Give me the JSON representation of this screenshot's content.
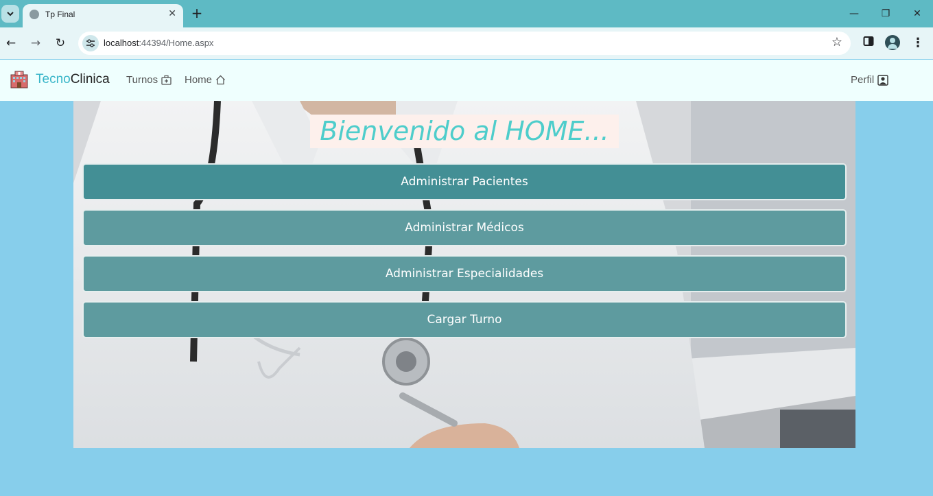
{
  "browser": {
    "tab_title": "Tp Final",
    "url_host": "localhost",
    "url_path": ":44394/Home.aspx"
  },
  "brand": {
    "part1": "Tecno",
    "part2": "Clinica",
    "color_part1": "#39b6c9"
  },
  "nav": {
    "turnos": "Turnos",
    "home": "Home",
    "perfil": "Perfil"
  },
  "hero": {
    "title": "Bienvenido al HOME..."
  },
  "buttons": [
    {
      "label": "Administrar Pacientes"
    },
    {
      "label": "Administrar Médicos"
    },
    {
      "label": "Administrar Especialidades"
    },
    {
      "label": "Cargar Turno"
    }
  ],
  "colors": {
    "page_bg": "#87CEEB",
    "button_active": "#438f95",
    "button": "#5e9b9f",
    "title": "#4ecdcb"
  }
}
